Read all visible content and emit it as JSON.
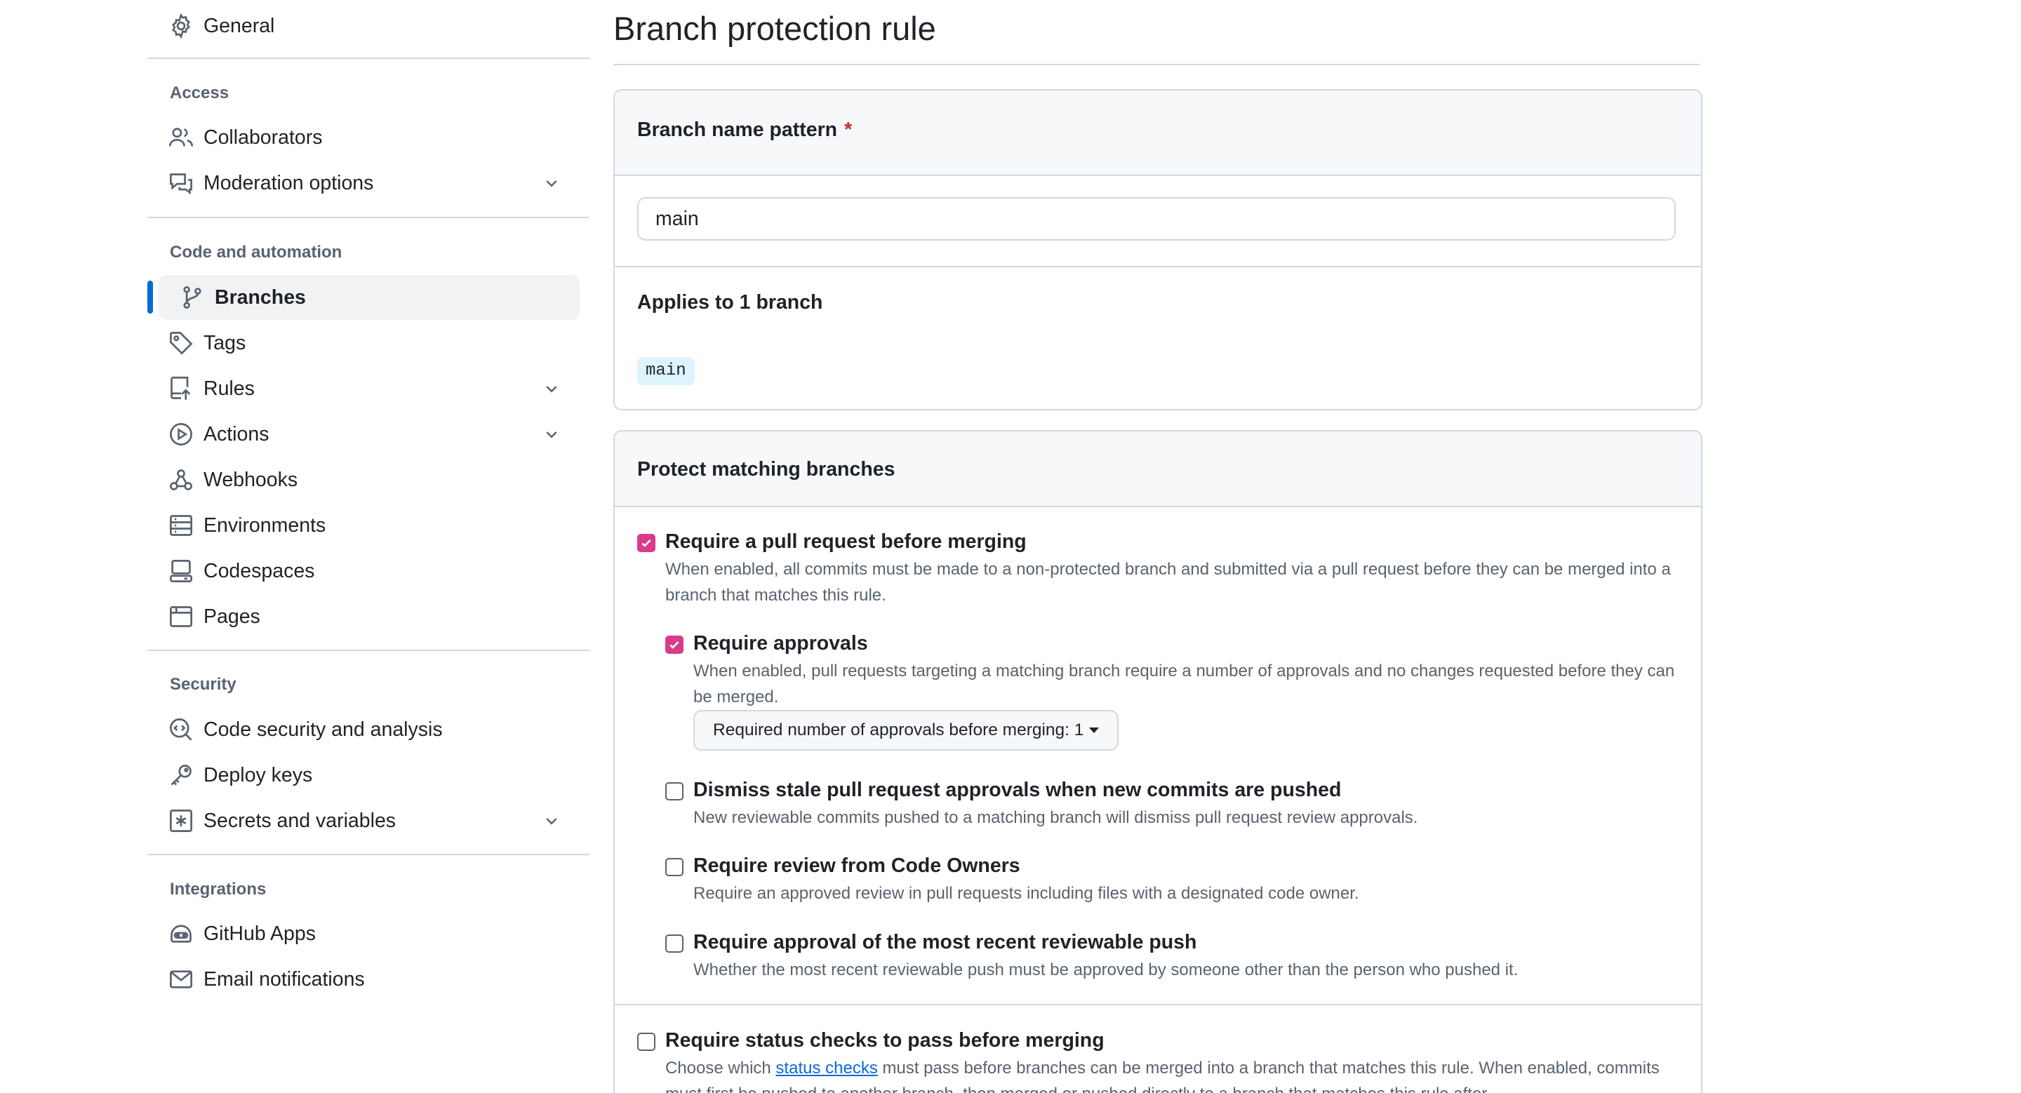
{
  "sidebar": {
    "general": {
      "label": "General",
      "icon": "gear-icon"
    },
    "groups": [
      {
        "title": "Access",
        "items": [
          {
            "label": "Collaborators",
            "icon": "people-icon",
            "expandable": false
          },
          {
            "label": "Moderation options",
            "icon": "comment-discussion-icon",
            "expandable": true
          }
        ]
      },
      {
        "title": "Code and automation",
        "items": [
          {
            "label": "Branches",
            "icon": "git-branch-icon",
            "expandable": false,
            "selected": true
          },
          {
            "label": "Tags",
            "icon": "tag-icon",
            "expandable": false
          },
          {
            "label": "Rules",
            "icon": "repo-push-icon",
            "expandable": true
          },
          {
            "label": "Actions",
            "icon": "play-icon",
            "expandable": true
          },
          {
            "label": "Webhooks",
            "icon": "webhook-icon",
            "expandable": false
          },
          {
            "label": "Environments",
            "icon": "server-icon",
            "expandable": false
          },
          {
            "label": "Codespaces",
            "icon": "codespaces-icon",
            "expandable": false
          },
          {
            "label": "Pages",
            "icon": "browser-icon",
            "expandable": false
          }
        ]
      },
      {
        "title": "Security",
        "items": [
          {
            "label": "Code security and analysis",
            "icon": "codescan-icon",
            "expandable": false
          },
          {
            "label": "Deploy keys",
            "icon": "key-icon",
            "expandable": false
          },
          {
            "label": "Secrets and variables",
            "icon": "key-asterisk-icon",
            "expandable": true
          }
        ]
      },
      {
        "title": "Integrations",
        "items": [
          {
            "label": "GitHub Apps",
            "icon": "hubot-icon",
            "expandable": false
          },
          {
            "label": "Email notifications",
            "icon": "mail-icon",
            "expandable": false
          }
        ]
      }
    ]
  },
  "main": {
    "title": "Branch protection rule",
    "pattern_box": {
      "title": "Branch name pattern",
      "required_marker": "*",
      "input_value": "main",
      "applies_title": "Applies to 1 branch",
      "branches": [
        "main"
      ]
    },
    "protect_box": {
      "title": "Protect matching branches",
      "options": {
        "require_pr": {
          "title": "Require a pull request before merging",
          "desc": "When enabled, all commits must be made to a non-protected branch and submitted via a pull request before they can be merged into a branch that matches this rule.",
          "checked": true
        },
        "require_approvals": {
          "title": "Require approvals",
          "desc": "When enabled, pull requests targeting a matching branch require a number of approvals and no changes requested before they can be merged.",
          "checked": true,
          "select_label": "Required number of approvals before merging: 1"
        },
        "dismiss_stale": {
          "title": "Dismiss stale pull request approvals when new commits are pushed",
          "desc": "New reviewable commits pushed to a matching branch will dismiss pull request review approvals.",
          "checked": false
        },
        "code_owners": {
          "title": "Require review from Code Owners",
          "desc": "Require an approved review in pull requests including files with a designated code owner.",
          "checked": false
        },
        "recent_push": {
          "title": "Require approval of the most recent reviewable push",
          "desc": "Whether the most recent reviewable push must be approved by someone other than the person who pushed it.",
          "checked": false
        },
        "status_checks": {
          "title": "Require status checks to pass before merging",
          "desc_before": "Choose which ",
          "desc_link": "status checks",
          "desc_after": " must pass before branches can be merged into a branch that matches this rule. When enabled, commits must first be pushed to another branch, then merged or pushed directly to a branch that matches this rule after",
          "checked": false
        }
      }
    }
  },
  "colors": {
    "accent_blue": "#0969da",
    "checkbox_pink": "#da3a8c",
    "required_red": "#d1242f",
    "muted_text": "#59636e",
    "border": "#d1d9e0",
    "header_bg": "#f6f8fa",
    "branch_pill_bg": "#ddf4ff"
  }
}
